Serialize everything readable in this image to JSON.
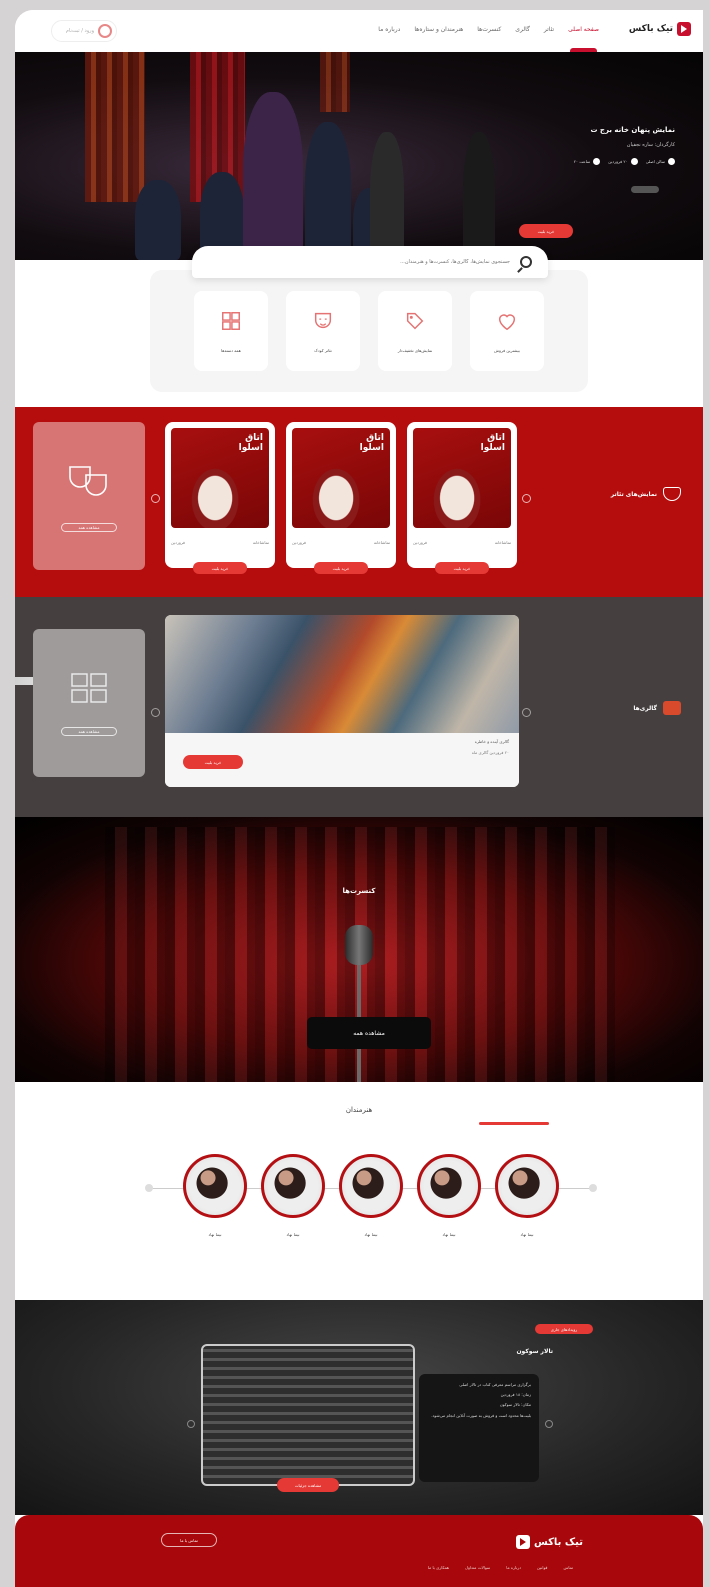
{
  "header": {
    "brand": "تیک باکس",
    "nav": [
      "صفحه اصلی",
      "تئاتر",
      "گالری",
      "کنسرت‌ها",
      "هنرمندان و ستاره‌ها",
      "درباره ما"
    ],
    "login_label": "ورود / ثبت‌نام"
  },
  "hero": {
    "title": "نمایش پنهان خانه برج ت",
    "subtitle": "کارگردان: ساره نجفیان",
    "meta": [
      "سالن اصلی",
      "۲۰ فروردین",
      "ساعت ۲۰"
    ],
    "cta": "خرید بلیت"
  },
  "search": {
    "placeholder": "جستجوی نمایش‌ها، گالری‌ها، کنسرت‌ها و هنرمندان..."
  },
  "categories": [
    {
      "label": "بیشترین فروش",
      "icon": "heart-icon"
    },
    {
      "label": "نمایش‌های تخفیف‌دار",
      "icon": "tag-icon"
    },
    {
      "label": "تئاتر کودک",
      "icon": "mask-icon"
    },
    {
      "label": "همه دسته‌ها",
      "icon": "grid-icon"
    }
  ],
  "theater": {
    "title": "نمایش‌های تئاتر",
    "more_label": "مشاهده همه",
    "cards": [
      {
        "poster_title": "اتاق\nاسلوا",
        "venue": "تماشاخانه",
        "date": "فروردین",
        "button": "خرید بلیت"
      },
      {
        "poster_title": "اتاق\nاسلوا",
        "venue": "تماشاخانه",
        "date": "فروردین",
        "button": "خرید بلیت"
      },
      {
        "poster_title": "اتاق\nاسلوا",
        "venue": "تماشاخانه",
        "date": "فروردین",
        "button": "خرید بلیت"
      }
    ]
  },
  "gallery": {
    "title": "گالری‌ها",
    "more_label": "مشاهده همه",
    "card": {
      "title": "گالری آینده و خاطره",
      "meta": "۲۰ فروردین      گالری ماه",
      "button": "خرید بلیت"
    }
  },
  "concert": {
    "title": "کنسرت‌ها",
    "button": "مشاهده همه"
  },
  "artists": {
    "title": "هنرمندان",
    "names": [
      "نیما نهاد",
      "نیما نهاد",
      "نیما نهاد",
      "نیما نهاد",
      "نیما نهاد"
    ]
  },
  "news": {
    "tag": "رویدادهای جاری",
    "title": "تالار سوکون",
    "lines": [
      "برگزاری مراسم معرفی کتاب در تالار اصلی",
      "زمان: ۱۸ فروردین",
      "مکان: تالار سوکون",
      "بلیت‌ها محدود است و فروش به صورت آنلاین انجام می‌شود."
    ],
    "button": "مشاهده جزئیات"
  },
  "footer": {
    "brand": "تیک باکس",
    "button": "تماس با ما",
    "links": [
      "تماس",
      "قوانین",
      "درباره ما",
      "سوالات متداول",
      "همکاری با ما"
    ]
  }
}
